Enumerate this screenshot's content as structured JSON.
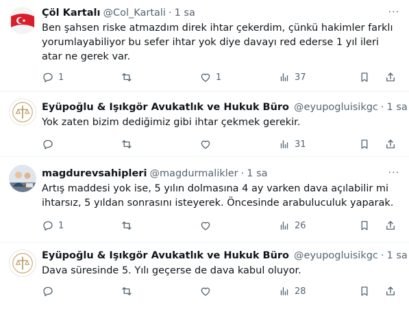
{
  "tweets": [
    {
      "name": "Çöl Kartalı",
      "handle": "@Col_Kartali",
      "time": "1 sa",
      "text": "Ben şahsen riske atmazdım direk ihtar çekerdim, çünkü hakimler farklı yorumlayabiliyor bu sefer ihtar yok diye davayı red ederse 1 yıl ileri atar ne gerek var.",
      "replies": "1",
      "retweets": "",
      "likes": "1",
      "views": "37",
      "verified": false,
      "avatar": "flag-avatar"
    },
    {
      "name": "Eyüpoğlu & Işıkgör Avukatlık ve Hukuk Büro",
      "handle": "@eyupogluisikgc",
      "time": "1 sa",
      "text": "Yok zaten bizim dediğimiz gibi ihtar çekmek gerekir.",
      "replies": "",
      "retweets": "",
      "likes": "",
      "views": "31",
      "verified": true,
      "avatar": "law-logo-avatar"
    },
    {
      "name": "magdurevsahipleri",
      "handle": "@magdurmalikler",
      "time": "1 sa",
      "text": "Artış maddesi yok ise, 5 yılın dolmasına 4 ay varken dava açılabilir mi ihtarsız, 5 yıldan sonrasını isteyerek. Öncesinde arabuluculuk yaparak.",
      "replies": "1",
      "retweets": "",
      "likes": "",
      "views": "26",
      "verified": false,
      "avatar": "people-avatar"
    },
    {
      "name": "Eyüpoğlu & Işıkgör Avukatlık ve Hukuk Büro",
      "handle": "@eyupogluisikgc",
      "time": "1 sa",
      "text": "Dava süresinde 5. Yılı geçerse de dava kabul oluyor.",
      "replies": "",
      "retweets": "",
      "likes": "",
      "views": "28",
      "verified": true,
      "avatar": "law-logo-avatar"
    }
  ],
  "colors": {
    "text": "#0f1419",
    "muted": "#536471",
    "verified": "#1d9bf0",
    "divider": "#eff3f4"
  },
  "more_glyph": "···",
  "dot": "·"
}
